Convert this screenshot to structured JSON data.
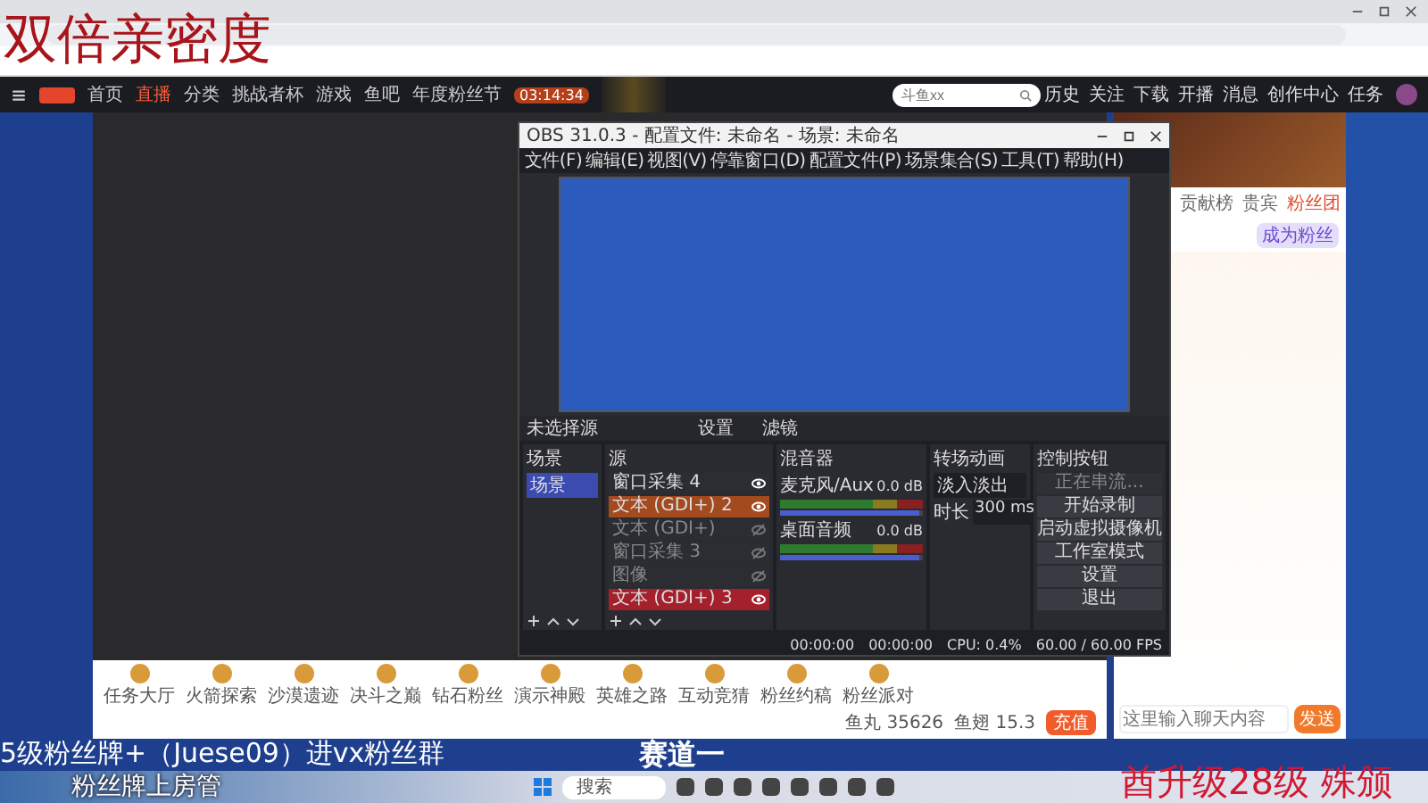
{
  "overlay": {
    "top_left": "双倍亲密度",
    "bottom_line_1": "5级粉丝牌+（Juese09）进vx粉丝群",
    "bottom_line_2": "粉丝牌上房管",
    "center": "赛道一",
    "bottom_right": "酋升级28级 殊颁"
  },
  "site_nav": {
    "items": [
      {
        "label": "首页",
        "selected": false
      },
      {
        "label": "直播",
        "selected": true
      },
      {
        "label": "分类",
        "selected": false
      },
      {
        "label": "挑战者杯",
        "selected": false
      },
      {
        "label": "游戏",
        "selected": false
      },
      {
        "label": "鱼吧",
        "selected": false
      },
      {
        "label": "年度粉丝节",
        "selected": false
      }
    ],
    "countdown": "03:14:34",
    "search": {
      "placeholder": "斗鱼xx"
    },
    "icons": [
      "历史",
      "关注",
      "下载",
      "开播",
      "消息",
      "创作中心",
      "任务"
    ]
  },
  "obs": {
    "title": "OBS 31.0.3 - 配置文件: 未命名 - 场景: 未命名",
    "menu": [
      "文件(F)",
      "编辑(E)",
      "视图(V)",
      "停靠窗口(D)",
      "配置文件(P)",
      "场景集合(S)",
      "工具(T)",
      "帮助(H)"
    ],
    "source_bar": {
      "label": "未选择源",
      "buttons": [
        "设置",
        "滤镜"
      ]
    },
    "scenes": {
      "title": "场景",
      "items": [
        {
          "label": "场景",
          "selected": true
        }
      ]
    },
    "sources": {
      "title": "源",
      "items": [
        {
          "label": "窗口采集 4",
          "color": "#2b2d33",
          "visible": true
        },
        {
          "label": "文本 (GDI+) 2",
          "color": "#a34a1f",
          "visible": true
        },
        {
          "label": "文本 (GDI+)",
          "color": "#2b2d33",
          "visible": false
        },
        {
          "label": "窗口采集 3",
          "color": "#2b2d33",
          "visible": false
        },
        {
          "label": "图像",
          "color": "#2b2d33",
          "visible": false
        },
        {
          "label": "文本 (GDI+) 3",
          "color": "#a3202c",
          "visible": true
        }
      ]
    },
    "mixer": {
      "title": "混音器",
      "channels": [
        {
          "name": "麦克风/Aux",
          "reading": "0.0 dB",
          "level": 0.97
        },
        {
          "name": "桌面音频",
          "reading": "0.0 dB",
          "level": 0.97
        }
      ]
    },
    "transitions": {
      "title": "转场动画",
      "type": "淡入淡出",
      "duration_label": "时长",
      "duration": "300 ms"
    },
    "controls": {
      "title": "控制按钮",
      "buttons": [
        {
          "label": "正在串流...",
          "disabled": true
        },
        {
          "label": "开始录制",
          "disabled": false
        },
        {
          "label": "启动虚拟摄像机",
          "disabled": false
        },
        {
          "label": "工作室模式",
          "disabled": false
        },
        {
          "label": "设置",
          "disabled": false
        },
        {
          "label": "退出",
          "disabled": false
        }
      ]
    },
    "status": [
      "00:00:00",
      "00:00:00",
      "CPU: 0.4%",
      "60.00 / 60.00 FPS"
    ]
  },
  "gift_bar": {
    "items": [
      "任务大厅",
      "火箭探索",
      "沙漠遗迹",
      "决斗之巅",
      "钻石粉丝",
      "演示神殿",
      "英雄之路",
      "互动竞猜",
      "粉丝约稿",
      "粉丝派对"
    ],
    "fish_balls": "鱼丸 35626",
    "fins": "鱼翅 15.3",
    "recharge": "充值"
  },
  "chat": {
    "tabs": [
      {
        "label": "贡献榜",
        "selected": false
      },
      {
        "label": "贵宾",
        "selected": false
      },
      {
        "label": "粉丝团",
        "selected": true
      }
    ],
    "follow": "成为粉丝",
    "send": "发送",
    "placeholder": "这里输入聊天内容"
  },
  "taskbar": {
    "search": "搜索"
  }
}
